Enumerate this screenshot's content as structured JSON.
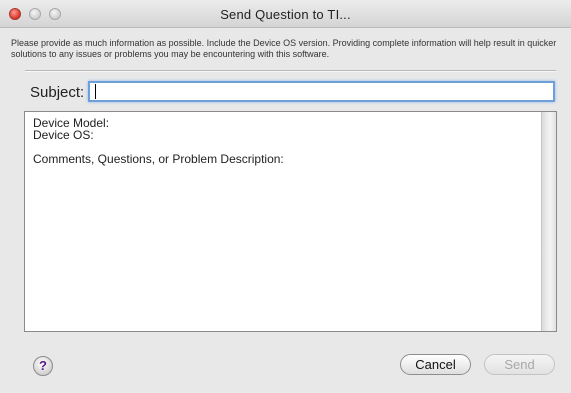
{
  "window": {
    "title": "Send Question to TI..."
  },
  "instructions": "Please provide as much information as possible.  Include the Device OS version.  Providing complete information will help result in quicker solutions to any issues or problems you may be encountering with this software.",
  "subject": {
    "label": "Subject:",
    "value": ""
  },
  "message": {
    "text": "Device Model:\nDevice OS:\n\nComments, Questions, or Problem Description:"
  },
  "buttons": {
    "help": "?",
    "cancel": "Cancel",
    "send": "Send"
  },
  "icons": {
    "close": "close-window-icon",
    "minimize": "minimize-window-icon",
    "zoom": "zoom-window-icon",
    "help": "help-icon"
  },
  "colors": {
    "focus_ring": "#6f9fd9",
    "close_button": "#d8342a",
    "help_glyph": "#5a1a8a"
  }
}
